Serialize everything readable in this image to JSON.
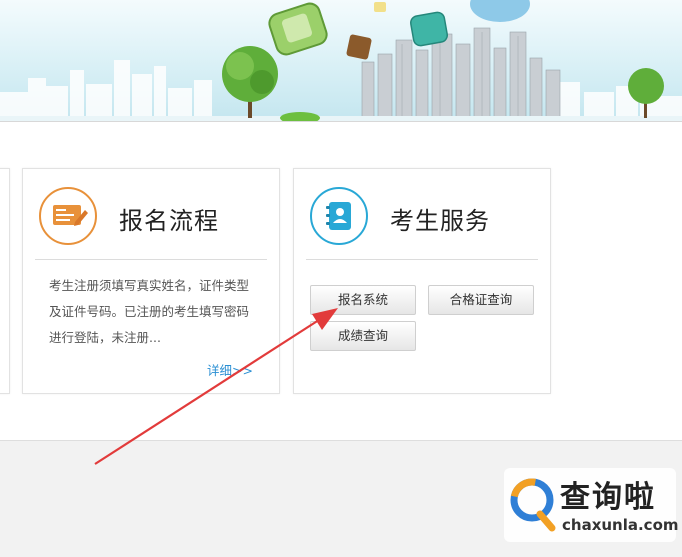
{
  "cards": {
    "process": {
      "title": "报名流程",
      "icon": "registration-form-icon",
      "accent": "#e8913a",
      "description": "考生注册须填写真实姓名，证件类型及证件号码。已注册的考生填写密码进行登陆，未注册...",
      "more_label": "详细>>"
    },
    "service": {
      "title": "考生服务",
      "icon": "contact-book-icon",
      "accent": "#29a8d6",
      "buttons": {
        "baoming": "报名系统",
        "hege": "合格证查询",
        "chengji": "成绩查询"
      }
    }
  },
  "watermark": {
    "cn": "查询啦",
    "en": "chaxunla.com"
  },
  "colors": {
    "arrow": "#e23b3b",
    "link": "#2a8fd3"
  }
}
